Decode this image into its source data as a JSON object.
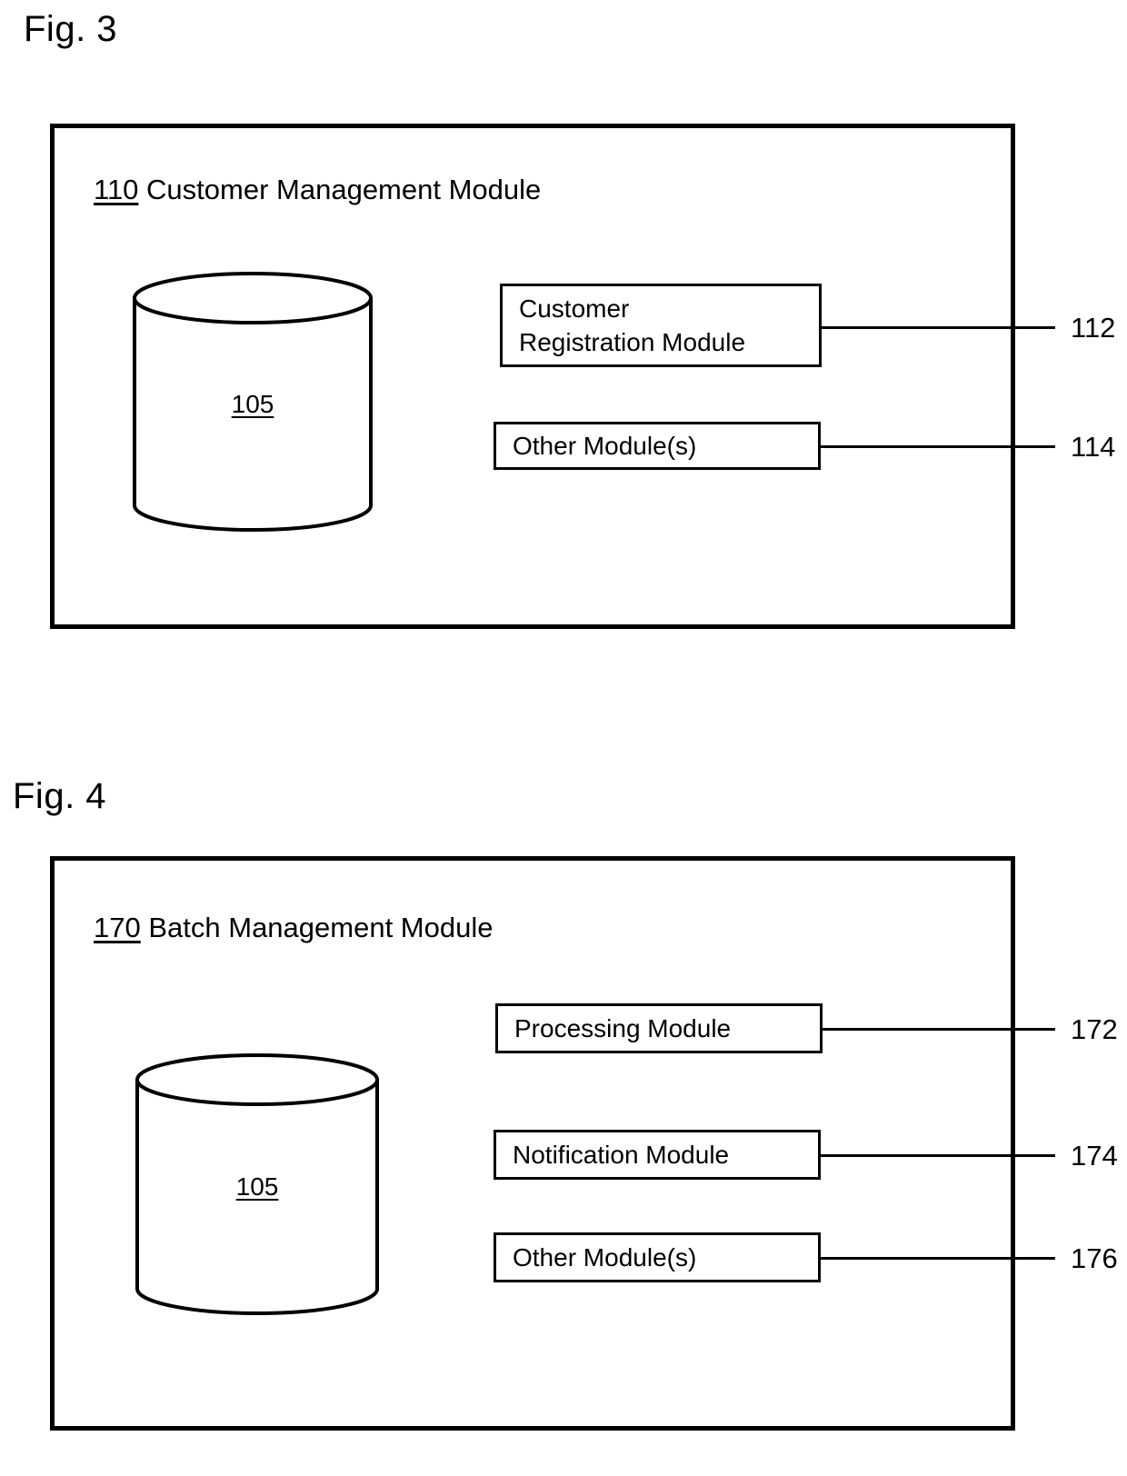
{
  "figures": [
    {
      "label": "Fig. 3",
      "outer_module": {
        "ref": "110",
        "title": "Customer Management Module"
      },
      "database": {
        "ref": "105",
        "icon": "database-cylinder-icon"
      },
      "modules": [
        {
          "ref": "112",
          "label": "Customer\nRegistration Module"
        },
        {
          "ref": "114",
          "label": "Other Module(s)"
        }
      ]
    },
    {
      "label": "Fig. 4",
      "outer_module": {
        "ref": "170",
        "title": "Batch Management Module"
      },
      "database": {
        "ref": "105",
        "icon": "database-cylinder-icon"
      },
      "modules": [
        {
          "ref": "172",
          "label": "Processing Module"
        },
        {
          "ref": "174",
          "label": "Notification Module"
        },
        {
          "ref": "176",
          "label": "Other Module(s)"
        }
      ]
    }
  ],
  "colors": {
    "stroke": "#000000",
    "background": "#ffffff"
  }
}
